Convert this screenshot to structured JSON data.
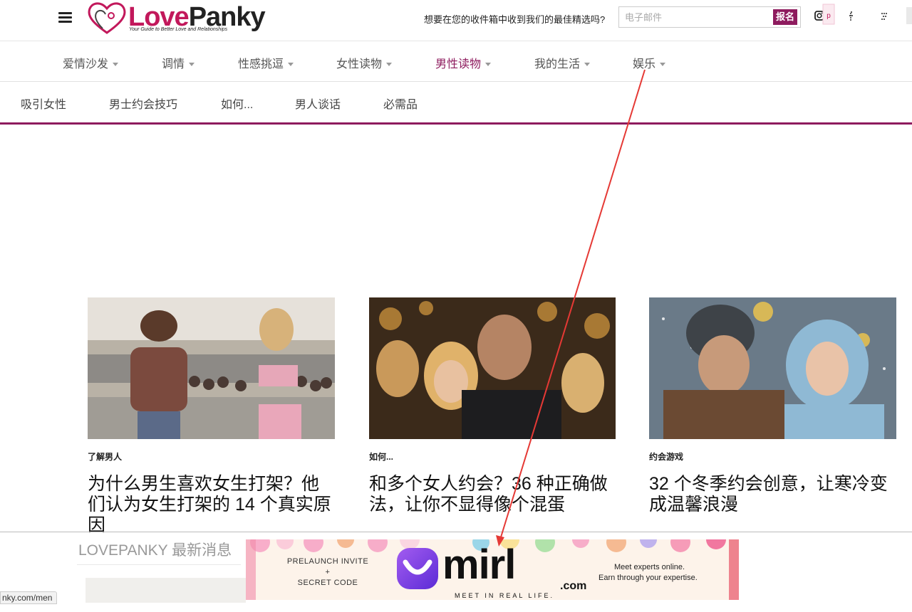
{
  "header": {
    "logo_love": "Love",
    "logo_panky": "Panky",
    "logo_tagline": "Your Guide to Better Love and Relationships",
    "subscribe_question": "想要在您的收件箱中收到我们的最佳精选吗?",
    "email_placeholder": "电子邮件",
    "signup_label": "报名",
    "social_icons": [
      "instagram-icon",
      "pinterest-icon",
      "facebook-icon",
      "twitter-icon",
      "flipboard-icon"
    ]
  },
  "main_nav": {
    "items": [
      {
        "label": "爱情沙发",
        "active": false
      },
      {
        "label": "调情",
        "active": false
      },
      {
        "label": "性感挑逗",
        "active": false
      },
      {
        "label": "女性读物",
        "active": false
      },
      {
        "label": "男性读物",
        "active": true
      },
      {
        "label": "我的生活",
        "active": false
      },
      {
        "label": "娱乐",
        "active": false
      }
    ]
  },
  "sub_nav": {
    "items": [
      "吸引女性",
      "男士约会技巧",
      "如何...",
      "男人谈话",
      "必需品"
    ]
  },
  "articles": [
    {
      "category": "了解男人",
      "title": "为什么男生喜欢女生打架？他们认为女生打架的 14 个真实原因"
    },
    {
      "category": "如何...",
      "title": "和多个女人约会？36 种正确做法，让你不显得像个混蛋"
    },
    {
      "category": "约会游戏",
      "title": "32 个冬季约会创意，让寒冷变成温馨浪漫"
    }
  ],
  "latest": {
    "heading": "LOVEPANKY 最新消息"
  },
  "status_url": "nky.com/men",
  "ad": {
    "left_line1": "PRELAUNCH INVITE",
    "left_line2": "+",
    "left_line3": "SECRET CODE",
    "brand": "mirl",
    "brand_suffix": ".com",
    "tagline": "MEET IN REAL LIFE.",
    "right_line1": "Meet experts online.",
    "right_line2": "Earn through your expertise."
  },
  "colors": {
    "brand_primary": "#8e1b5e",
    "logo_pink": "#c2185b",
    "annotation_arrow": "#e53935"
  }
}
